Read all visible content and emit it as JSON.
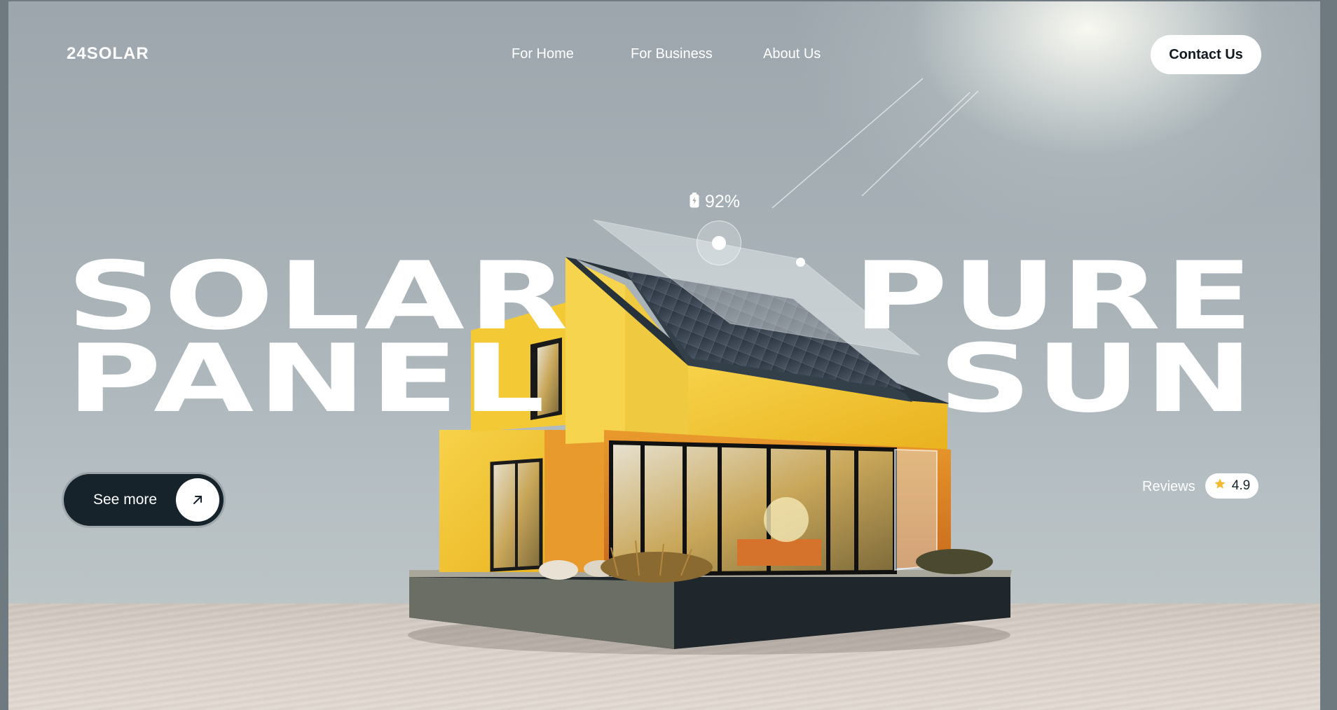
{
  "brand": {
    "logo": "24SOLAR"
  },
  "nav": {
    "links": [
      "For Home",
      "For Business",
      "About Us"
    ],
    "contact_label": "Contact Us"
  },
  "hero": {
    "left_lines": [
      "SOLAR",
      "PANEL"
    ],
    "right_lines": [
      "PURE",
      "SUN"
    ],
    "cta_label": "See more",
    "cta_icon": "arrow-up-right-icon"
  },
  "battery": {
    "value": "92%",
    "icon": "battery-icon"
  },
  "reviews": {
    "label": "Reviews",
    "rating": "4.9",
    "icon": "star-icon"
  },
  "colors": {
    "sky": "#a8b2b7",
    "sand": "#d9d0c9",
    "button_dark": "#16232a",
    "wall_yellow": "#f2c630",
    "star": "#f5b82e"
  }
}
